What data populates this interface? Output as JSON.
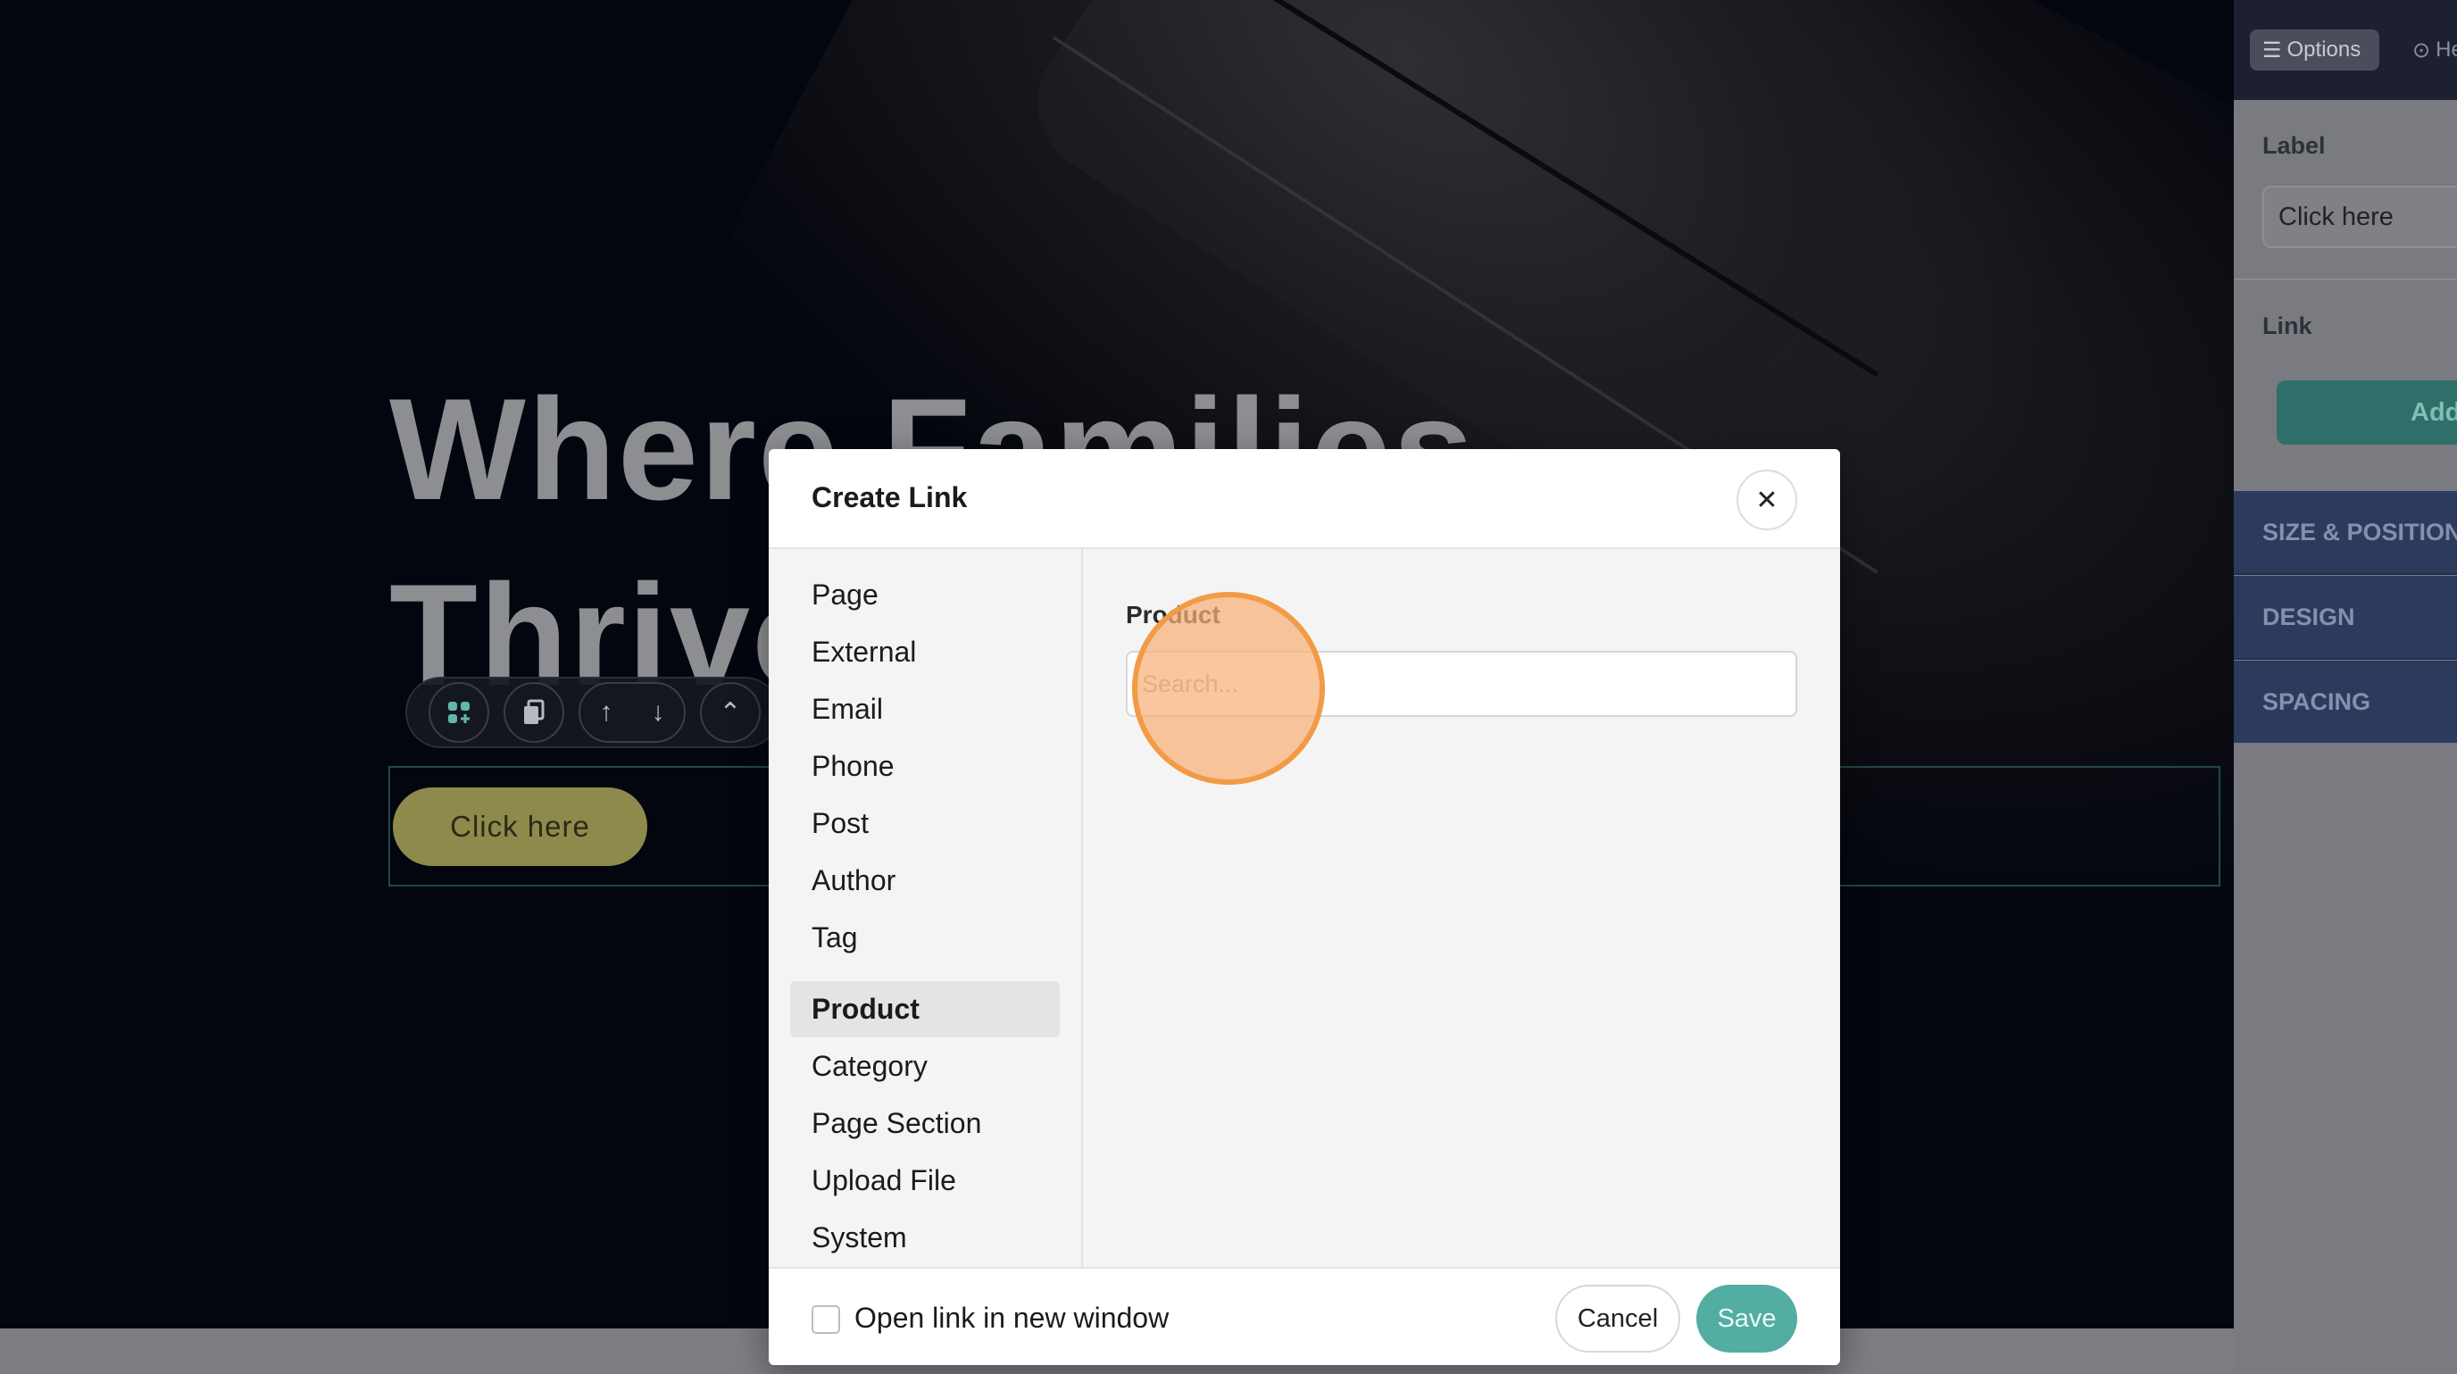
{
  "canvas": {
    "hero_title": "Where Families Thrive Throu",
    "cta_label": "Click here",
    "toolbar_icons": [
      "add-block-icon",
      "duplicate-icon",
      "move-up-icon",
      "move-down-icon",
      "move-top-icon"
    ]
  },
  "panel": {
    "options_tab": "Options",
    "help_tab": "He",
    "label_heading": "Label",
    "label_value": "Click here",
    "link_heading": "Link",
    "add_button": "Add",
    "sections": [
      "SIZE & POSITION",
      "DESIGN",
      "SPACING"
    ]
  },
  "dialog": {
    "title": "Create Link",
    "link_types": [
      "Page",
      "External",
      "Email",
      "Phone",
      "Post",
      "Author",
      "Tag",
      "Product",
      "Category",
      "Page Section",
      "Upload File",
      "System"
    ],
    "active_type": "Product",
    "field_label": "Product",
    "search_placeholder": "Search...",
    "open_new_window_label": "Open link in new window",
    "open_new_window_checked": false,
    "cancel_label": "Cancel",
    "save_label": "Save"
  },
  "colors": {
    "accent": "#52ada2",
    "cta": "#8d8a4c",
    "click_highlight": "#f29a45"
  }
}
